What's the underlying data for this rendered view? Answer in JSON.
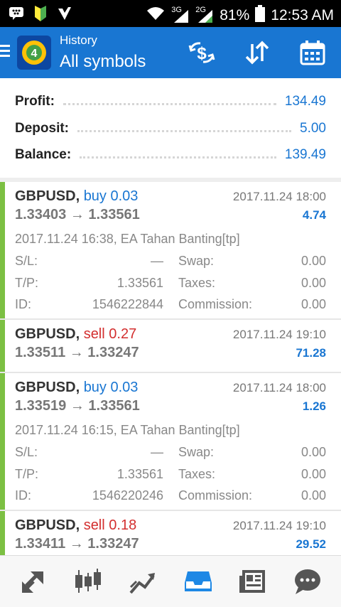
{
  "status_bar": {
    "battery": "81%",
    "time": "12:53 AM",
    "net1": "3G",
    "net2": "2G"
  },
  "header": {
    "subtitle": "History",
    "title": "All symbols"
  },
  "summary": [
    {
      "label": "Profit:",
      "value": "134.49"
    },
    {
      "label": "Deposit:",
      "value": "5.00"
    },
    {
      "label": "Balance:",
      "value": "139.49"
    }
  ],
  "trades": [
    {
      "symbol": "GBPUSD,",
      "side": "buy",
      "volume": "0.03",
      "time": "2017.11.24 18:00",
      "prices": "1.33403 → 1.33561",
      "profit": "4.74",
      "comment": "2017.11.24 16:38, EA Tahan Banting[tp]",
      "sl_label": "S/L:",
      "sl": "—",
      "swap_label": "Swap:",
      "swap": "0.00",
      "tp_label": "T/P:",
      "tp": "1.33561",
      "taxes_label": "Taxes:",
      "taxes": "0.00",
      "id_label": "ID:",
      "id": "1546222844",
      "commission_label": "Commission:",
      "commission": "0.00"
    },
    {
      "symbol": "GBPUSD,",
      "side": "sell",
      "volume": "0.27",
      "time": "2017.11.24 19:10",
      "prices": "1.33511 → 1.33247",
      "profit": "71.28"
    },
    {
      "symbol": "GBPUSD,",
      "side": "buy",
      "volume": "0.03",
      "time": "2017.11.24 18:00",
      "prices": "1.33519 → 1.33561",
      "profit": "1.26",
      "comment": "2017.11.24 16:15, EA Tahan Banting[tp]",
      "sl_label": "S/L:",
      "sl": "—",
      "swap_label": "Swap:",
      "swap": "0.00",
      "tp_label": "T/P:",
      "tp": "1.33561",
      "taxes_label": "Taxes:",
      "taxes": "0.00",
      "id_label": "ID:",
      "id": "1546220246",
      "commission_label": "Commission:",
      "commission": "0.00"
    },
    {
      "symbol": "GBPUSD,",
      "side": "sell",
      "volume": "0.18",
      "time": "2017.11.24 19:10",
      "prices": "1.33411 → 1.33247",
      "profit": "29.52"
    }
  ],
  "colors": {
    "appbar": "#1976d2",
    "buy": "#1976d2",
    "sell": "#d32f2f",
    "accent_bar": "#7cc043"
  },
  "icons": {
    "appbar": [
      "currency-exchange-icon",
      "sort-icon",
      "calendar-icon"
    ],
    "nav": [
      "quotes-icon",
      "chart-candles-icon",
      "trade-icon",
      "history-icon",
      "news-icon",
      "chat-icon"
    ]
  }
}
